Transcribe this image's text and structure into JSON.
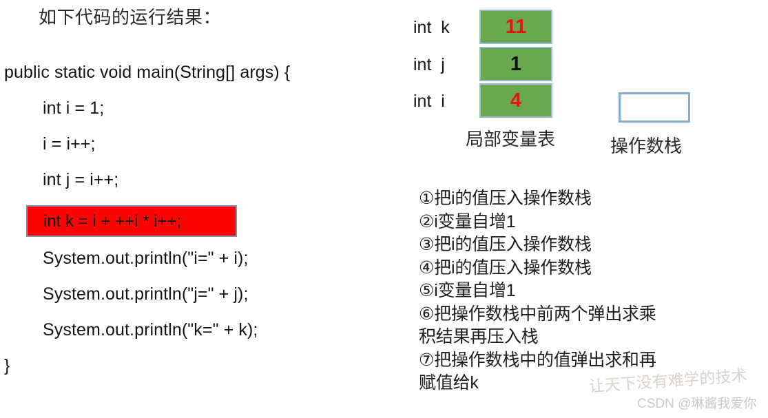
{
  "slide": {
    "title": "如下代码的运行结果："
  },
  "code": {
    "lines": [
      "public static void main(String[] args) {",
      "int i = 1;",
      "i = i++;",
      "int j = i++;"
    ],
    "highlighted_line": "int k = i + ++i * i++;",
    "highlight_bg": "#fd0404",
    "after_lines": [
      "System.out.println(\"i=\" + i);",
      "System.out.println(\"j=\" + j);",
      "System.out.println(\"k=\" + k);"
    ],
    "closing_brace": "}"
  },
  "local_variable_table": {
    "caption": "局部变量表",
    "cell_color": "#6aa84f",
    "border_color": "#9ab7d3",
    "rows": [
      {
        "label": "int  k",
        "value": "11",
        "value_color": "#f01010"
      },
      {
        "label": "int  j",
        "value": "1",
        "value_color": "#101010"
      },
      {
        "label": "int  i",
        "value": "4",
        "value_color": "#f01010"
      }
    ]
  },
  "operand_stack": {
    "caption": "操作数栈",
    "value": "",
    "border_color": "#82abd8"
  },
  "steps": {
    "lines": [
      "①把i的值压入操作数栈",
      "②i变量自增1",
      "③把i的值压入操作数栈",
      "④把i的值压入操作数栈",
      "⑤i变量自增1",
      "⑥把操作数栈中前两个弹出求乘",
      "积结果再压入栈",
      "⑦把操作数栈中的值弹出求和再",
      "赋值给k"
    ]
  },
  "watermark": {
    "brush": "让天下没有难学的技术",
    "csdn": "CSDN @琳酱我爱你"
  }
}
